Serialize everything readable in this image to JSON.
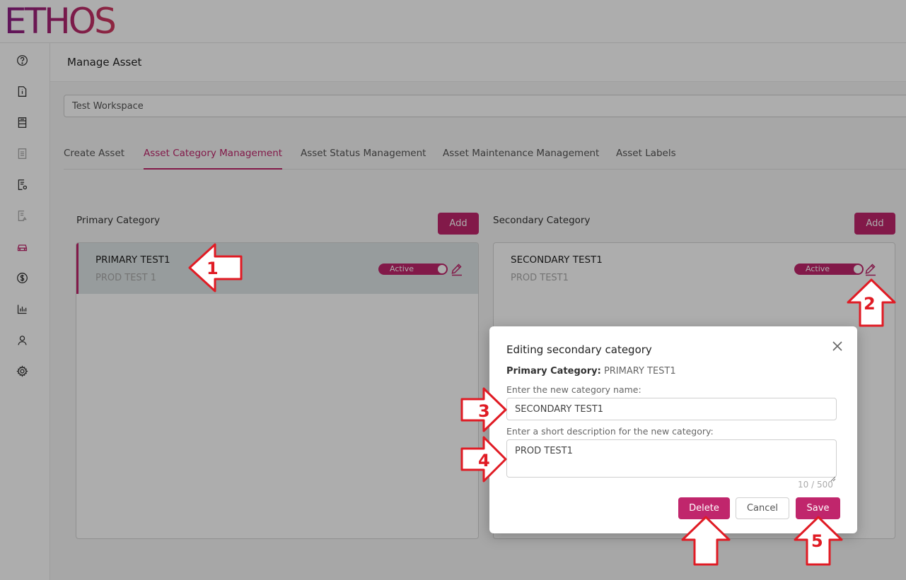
{
  "app": {
    "logo": "ETHOS"
  },
  "sidebar": {
    "icons": [
      "help-icon",
      "document-info-icon",
      "list-document-icon",
      "disabled-document-icon",
      "document-settings-icon",
      "disabled-report-icon",
      "car-icon",
      "dollar-icon",
      "bar-chart-icon",
      "user-icon",
      "gear-icon"
    ]
  },
  "page": {
    "title": "Manage Asset"
  },
  "workspace": {
    "value": "Test Workspace"
  },
  "tabs": [
    {
      "label": "Create Asset",
      "active": false
    },
    {
      "label": "Asset Category Management",
      "active": true
    },
    {
      "label": "Asset Status Management",
      "active": false
    },
    {
      "label": "Asset Maintenance Management",
      "active": false
    },
    {
      "label": "Asset Labels",
      "active": false
    }
  ],
  "primary": {
    "heading": "Primary Category",
    "add_label": "Add",
    "items": [
      {
        "name": "PRIMARY TEST1",
        "description": "PROD TEST 1",
        "status": "Active",
        "selected": true
      }
    ]
  },
  "secondary": {
    "heading": "Secondary Category",
    "add_label": "Add",
    "items": [
      {
        "name": "SECONDARY TEST1",
        "description": "PROD TEST1",
        "status": "Active"
      }
    ]
  },
  "modal": {
    "title": "Editing secondary category",
    "primary_label": "Primary Category:",
    "primary_value": "PRIMARY TEST1",
    "name_label": "Enter the new category name:",
    "name_value": "SECONDARY TEST1",
    "desc_label": "Enter a short description for the new category:",
    "desc_value": "PROD TEST1",
    "char_count": "10 / 500",
    "delete_label": "Delete",
    "cancel_label": "Cancel",
    "save_label": "Save"
  },
  "annotations": [
    "1",
    "2",
    "3",
    "4",
    "5"
  ],
  "colors": {
    "accent": "#c0266c",
    "annotation": "#e01b24",
    "selected_row": "#dfe6e7"
  }
}
